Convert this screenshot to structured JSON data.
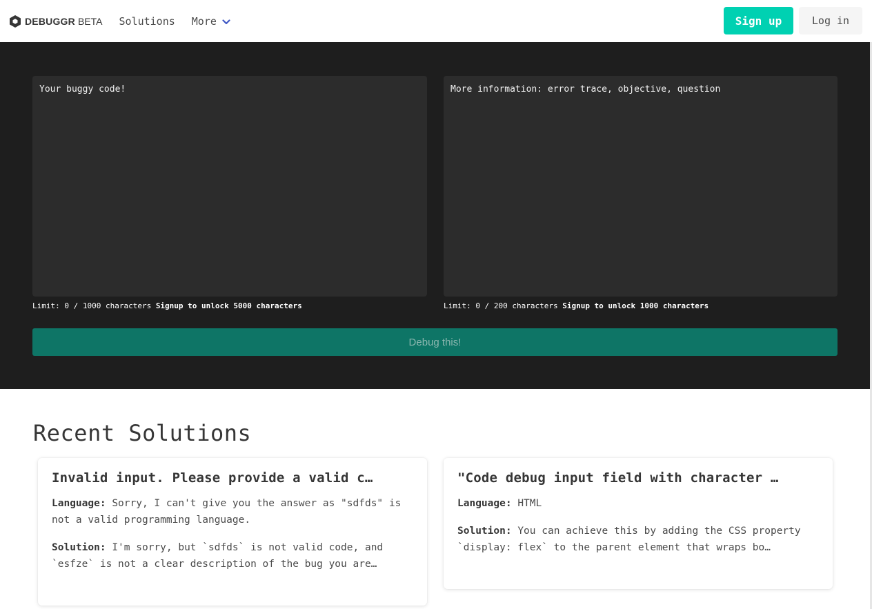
{
  "navbar": {
    "brand": "DEBUGGR",
    "beta": "BETA",
    "solutions_label": "Solutions",
    "more_label": "More",
    "signup_label": "Sign up",
    "login_label": "Log in"
  },
  "hero": {
    "code_placeholder": "Your buggy code!",
    "info_placeholder": "More information: error trace, objective, question",
    "code_limit_text": "Limit: 0 / 1000 characters",
    "code_unlock_text": "Signup to unlock 5000 characters",
    "info_limit_text": "Limit: 0 / 200 characters",
    "info_unlock_text": "Signup to unlock 1000 characters",
    "debug_button": "Debug this!"
  },
  "recent": {
    "title": "Recent Solutions",
    "language_key": "Language:",
    "solution_key": "Solution:",
    "cards": [
      {
        "title": "Invalid input. Please provide a valid c…",
        "language": "Sorry, I can't give you the answer as \"sdfds\" is not a valid programming language.",
        "solution": "I'm sorry, but `sdfds` is not valid code, and `esfze` is not a clear description of the bug you are…"
      },
      {
        "title": "\"Code debug input field with character …",
        "language": "HTML",
        "solution": "You can achieve this by adding the CSS property `display: flex` to the parent element that wraps bo…"
      }
    ]
  },
  "colors": {
    "accent": "#00d1b2",
    "hero_bg": "#1e1e1e",
    "editor_bg": "#2c2c2c",
    "debug_button_bg": "#0e7566",
    "chevron": "#3e56c4"
  }
}
